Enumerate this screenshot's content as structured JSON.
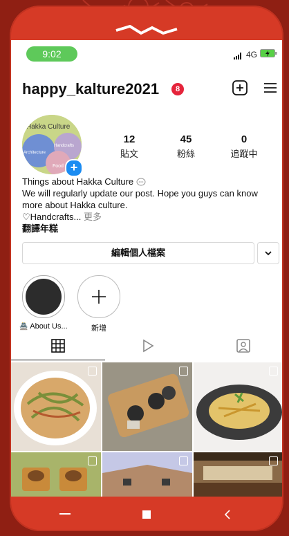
{
  "status_bar": {
    "time": "9:02",
    "network": "4G"
  },
  "profile": {
    "username": "happy_kalture2021",
    "notification_count": "8",
    "avatar_text": {
      "title": "Hakka Culture",
      "handcrafts": "Handcrafts",
      "architecture": "Architecture",
      "food": "Food"
    },
    "stats": [
      {
        "value": "12",
        "label": "貼文"
      },
      {
        "value": "45",
        "label": "粉絲"
      },
      {
        "value": "0",
        "label": "追蹤中"
      }
    ],
    "bio": {
      "line1": "Things about Hakka Culture",
      "line2": "We will regularly update our post. Hope you guys can know more about Hakka culture.",
      "line3": "♡Handcrafts...",
      "more": " 更多",
      "line4": "翻譯年糕"
    },
    "edit_button": "編輯個人檔案"
  },
  "highlights": [
    {
      "label": "About Us...",
      "icon": "about-emoji"
    },
    {
      "label": "新增",
      "icon": "plus-icon"
    }
  ],
  "tabs": [
    "grid-icon",
    "reels-icon",
    "tagged-icon"
  ],
  "colors": {
    "accent": "#d63a26",
    "time_pill": "#5ec95a",
    "badge": "#e5243b",
    "add": "#1b8cf2"
  }
}
